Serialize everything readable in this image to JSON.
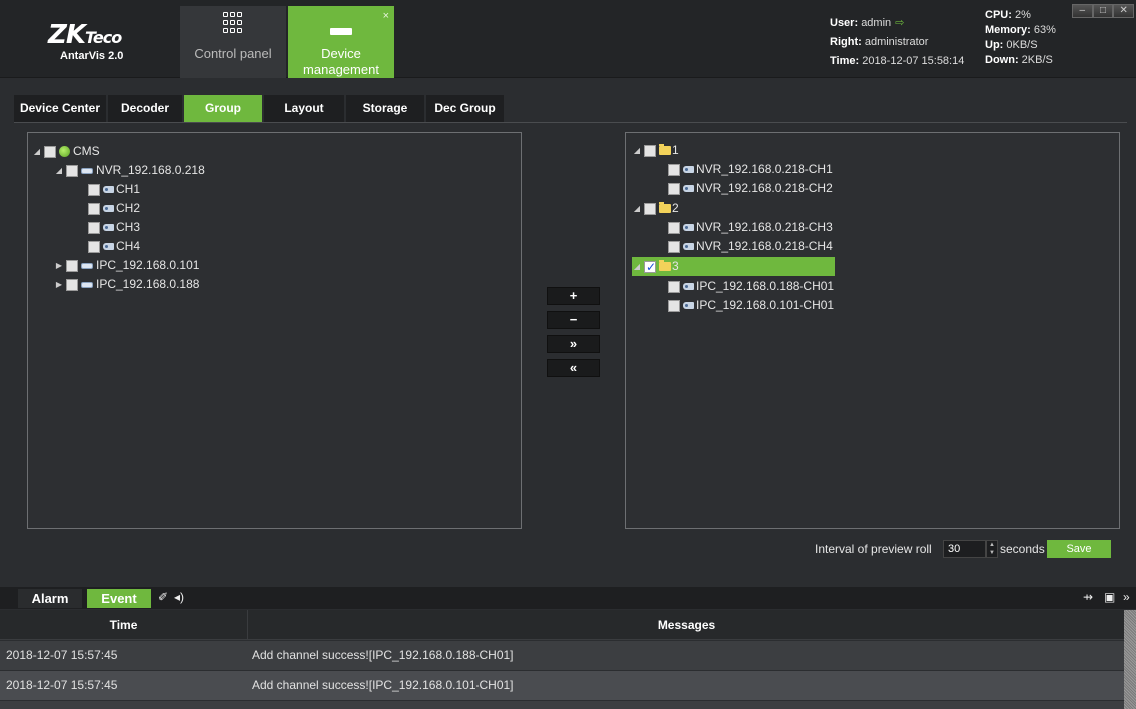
{
  "app": {
    "logo_main": "ZK",
    "logo_tail": "Teco",
    "product": "AntarVis 2.0"
  },
  "nav": {
    "control_panel": "Control panel",
    "device_management": "Device management",
    "close_glyph": "×"
  },
  "status": {
    "user_label": "User:",
    "user": "admin",
    "right_label": "Right:",
    "right": "administrator",
    "time_label": "Time:",
    "time": "2018-12-07 15:58:14",
    "cpu_label": "CPU:",
    "cpu": "2%",
    "memory_label": "Memory:",
    "memory": "63%",
    "up_label": "Up:",
    "up": "0KB/S",
    "down_label": "Down:",
    "down": "2KB/S"
  },
  "window_controls": [
    "–",
    "□",
    "✕"
  ],
  "tabs": [
    {
      "label": "Device Center",
      "active": false
    },
    {
      "label": "Decoder",
      "active": false
    },
    {
      "label": "Group",
      "active": true
    },
    {
      "label": "Layout",
      "active": false
    },
    {
      "label": "Storage",
      "active": false
    },
    {
      "label": "Dec Group",
      "active": false
    }
  ],
  "device_tree": [
    {
      "label": "CMS",
      "level": 0,
      "icon": "globe-icon",
      "expanded": true
    },
    {
      "label": "NVR_192.168.0.218",
      "level": 1,
      "icon": "nvr-icon",
      "expanded": true
    },
    {
      "label": "CH1",
      "level": 2,
      "icon": "camera-icon"
    },
    {
      "label": "CH2",
      "level": 2,
      "icon": "camera-icon"
    },
    {
      "label": "CH3",
      "level": 2,
      "icon": "camera-icon"
    },
    {
      "label": "CH4",
      "level": 2,
      "icon": "camera-icon"
    },
    {
      "label": "IPC_192.168.0.101",
      "level": 1,
      "icon": "ipc-icon",
      "expanded": false
    },
    {
      "label": "IPC_192.168.0.188",
      "level": 1,
      "icon": "ipc-icon",
      "expanded": false
    }
  ],
  "group_tree": [
    {
      "label": "1",
      "level": 0,
      "icon": "folder-icon",
      "expanded": true,
      "checked": false
    },
    {
      "label": "NVR_192.168.0.218-CH1",
      "level": 1,
      "icon": "camera-icon",
      "checked": false
    },
    {
      "label": "NVR_192.168.0.218-CH2",
      "level": 1,
      "icon": "camera-icon",
      "checked": false
    },
    {
      "label": "2",
      "level": 0,
      "icon": "folder-icon",
      "expanded": true,
      "checked": false
    },
    {
      "label": "NVR_192.168.0.218-CH3",
      "level": 1,
      "icon": "camera-icon",
      "checked": false
    },
    {
      "label": "NVR_192.168.0.218-CH4",
      "level": 1,
      "icon": "camera-icon",
      "checked": false
    },
    {
      "label": "3",
      "level": 0,
      "icon": "folder-icon",
      "expanded": true,
      "checked": true,
      "selected": true
    },
    {
      "label": "IPC_192.168.0.188-CH01",
      "level": 1,
      "icon": "camera-icon",
      "checked": false
    },
    {
      "label": "IPC_192.168.0.101-CH01",
      "level": 1,
      "icon": "camera-icon",
      "checked": false
    }
  ],
  "transfer_buttons": {
    "add": "+",
    "remove": "−",
    "add_all": "»",
    "remove_all": "«"
  },
  "preview_roll": {
    "label": "Interval of preview roll",
    "value": "30",
    "unit": "seconds",
    "save": "Save"
  },
  "bottom": {
    "alarm_tab": "Alarm",
    "event_tab": "Event",
    "col_time": "Time",
    "col_messages": "Messages",
    "rows": [
      {
        "time": "2018-12-07 15:57:45",
        "message": "Add channel success![IPC_192.168.0.188-CH01]"
      },
      {
        "time": "2018-12-07 15:57:45",
        "message": "Add channel success![IPC_192.168.0.101-CH01]"
      }
    ]
  },
  "colors": {
    "accent": "#6fb83e",
    "background": "#2b2d30",
    "header": "#232527"
  }
}
